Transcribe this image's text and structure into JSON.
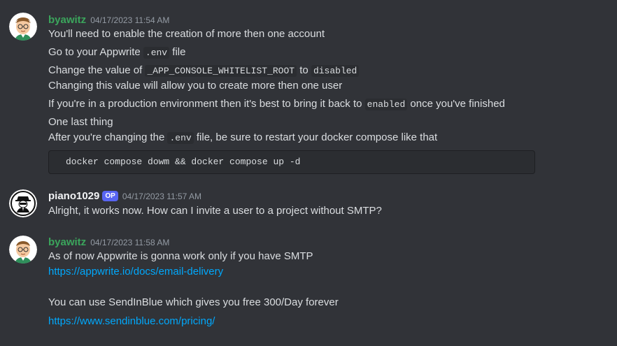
{
  "messages": [
    {
      "author": "byawitz",
      "timestamp": "04/17/2023 11:54 AM",
      "lines": {
        "l1": "You'll need to enable the creation of more then one account",
        "l2_pre": "Go to your Appwrite ",
        "l2_code": ".env",
        "l2_post": " file",
        "l3_pre": "Change the value of ",
        "l3_code": "_APP_CONSOLE_WHITELIST_ROOT",
        "l3_mid": " to ",
        "l3_code2": "disabled",
        "l4": "Changing this value will allow you to create more then one user",
        "l5_pre": "If you're in a production environment then it's best to bring it back to ",
        "l5_code": "enabled",
        "l5_post": " once you've finished",
        "l6": "One last thing",
        "l7_pre": "After you're changing the ",
        "l7_code": ".env",
        "l7_post": " file, be sure to restart your docker compose like that",
        "codeblock": "docker compose dowm && docker compose up -d"
      }
    },
    {
      "author": "piano1029",
      "badge": "OP",
      "timestamp": "04/17/2023 11:57 AM",
      "text": "Alright, it works now. How can I invite a user to a project without SMTP?"
    },
    {
      "author": "byawitz",
      "timestamp": "04/17/2023 11:58 AM",
      "text1": "As of now Appwrite is gonna work only if you have SMTP",
      "link1": "https://appwrite.io/docs/email-delivery",
      "text2": "You can use SendInBlue which gives you free 300/Day forever",
      "link2": "https://www.sendinblue.com/pricing/"
    }
  ],
  "colors": {
    "background": "#313338",
    "username_green": "#3ba55c",
    "link": "#00a8fc",
    "op_badge": "#5865f2"
  }
}
